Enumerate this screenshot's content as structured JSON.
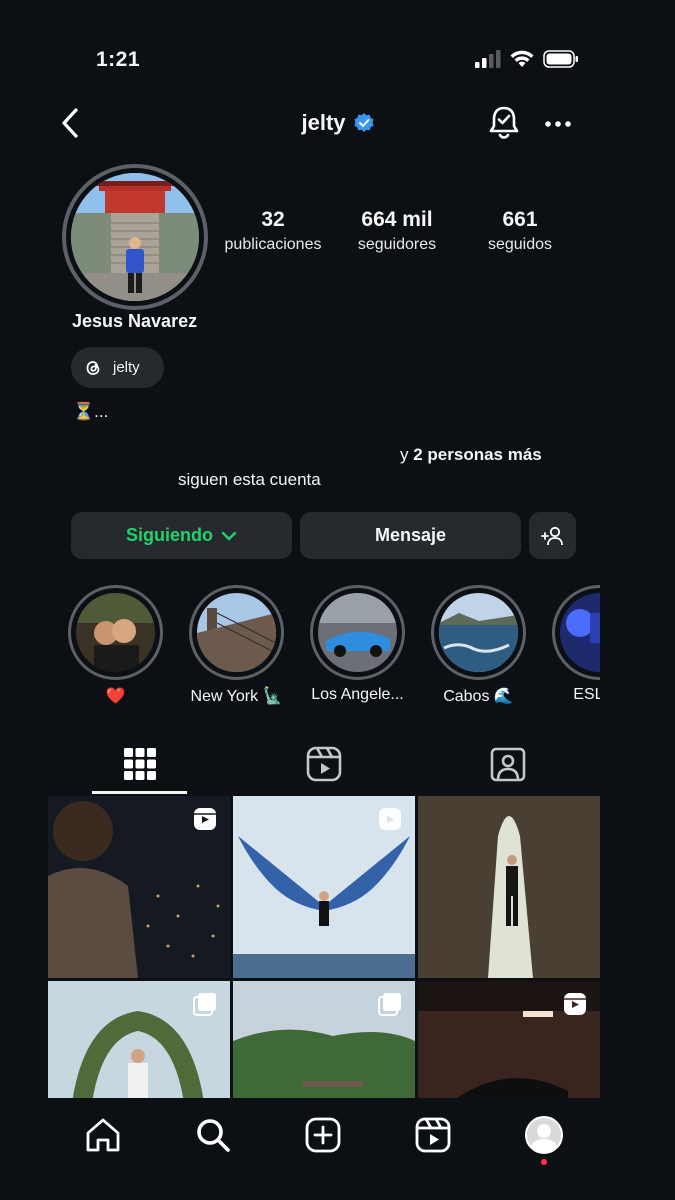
{
  "status_bar": {
    "time": "1:21"
  },
  "header": {
    "username": "jelty",
    "verified": true
  },
  "profile": {
    "name": "Jesus Navarez",
    "stats": [
      {
        "value": "32",
        "label": "publicaciones"
      },
      {
        "value": "664 mil",
        "label": "seguidores"
      },
      {
        "value": "661",
        "label": "seguidos"
      }
    ],
    "threads_handle": "jelty",
    "bio": "⏳...",
    "followed_by_prefix": "y ",
    "followed_by_others": "2 personas más",
    "followed_by_suffix": "siguen esta cuenta"
  },
  "buttons": {
    "following_label": "Siguiendo",
    "message_label": "Mensaje"
  },
  "highlights": [
    {
      "label": "❤️"
    },
    {
      "label": "New York 🗽"
    },
    {
      "label": "Los Angele..."
    },
    {
      "label": "Cabos 🌊"
    },
    {
      "label": "ESLAN"
    }
  ],
  "tabs": [
    "grid-icon",
    "reels-icon",
    "tagged-icon"
  ],
  "grid_posts": [
    {
      "type": "reel"
    },
    {
      "type": "reel"
    },
    {
      "type": "photo"
    },
    {
      "type": "carousel"
    },
    {
      "type": "carousel"
    },
    {
      "type": "reel"
    }
  ],
  "colors": {
    "accent_following": "#1fd36a",
    "verified": "#3897f0",
    "notification_dot": "#ff3040"
  }
}
